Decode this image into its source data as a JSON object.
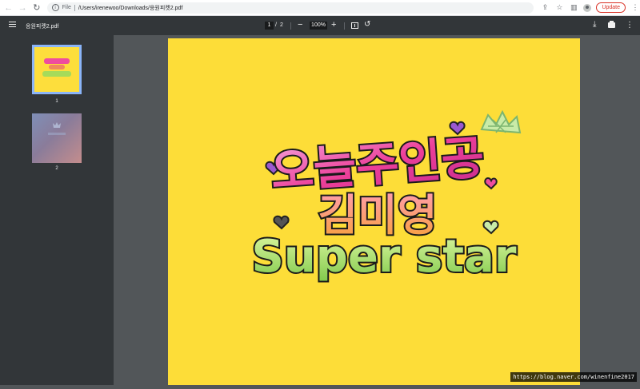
{
  "browser": {
    "nav": {
      "back": "←",
      "forward": "→",
      "reload": "↻"
    },
    "omnibox": {
      "scheme": "File",
      "path": "/Users/irenewoo/Downloads/응원피켓2.pdf"
    },
    "update_label": "Update"
  },
  "pdf_toolbar": {
    "title": "응원피켓2.pdf",
    "current_page": "1",
    "page_separator": "/",
    "total_pages": "2",
    "zoom": "100%",
    "zoom_out": "−",
    "zoom_in": "+"
  },
  "sidebar": {
    "thumbnails": [
      {
        "label": "1",
        "selected": true
      },
      {
        "label": "2",
        "selected": false
      }
    ]
  },
  "page": {
    "artwork_line1": "오늘주인공",
    "artwork_line2": "김미영",
    "artwork_line3": "Super star",
    "background_color": "#fddd38"
  },
  "watermark": "https://blog.naver.com/winenfine2017",
  "colors": {
    "toolbar": "#323639",
    "viewer": "#525659",
    "accent": "#8ab4f8",
    "update": "#d93025"
  }
}
